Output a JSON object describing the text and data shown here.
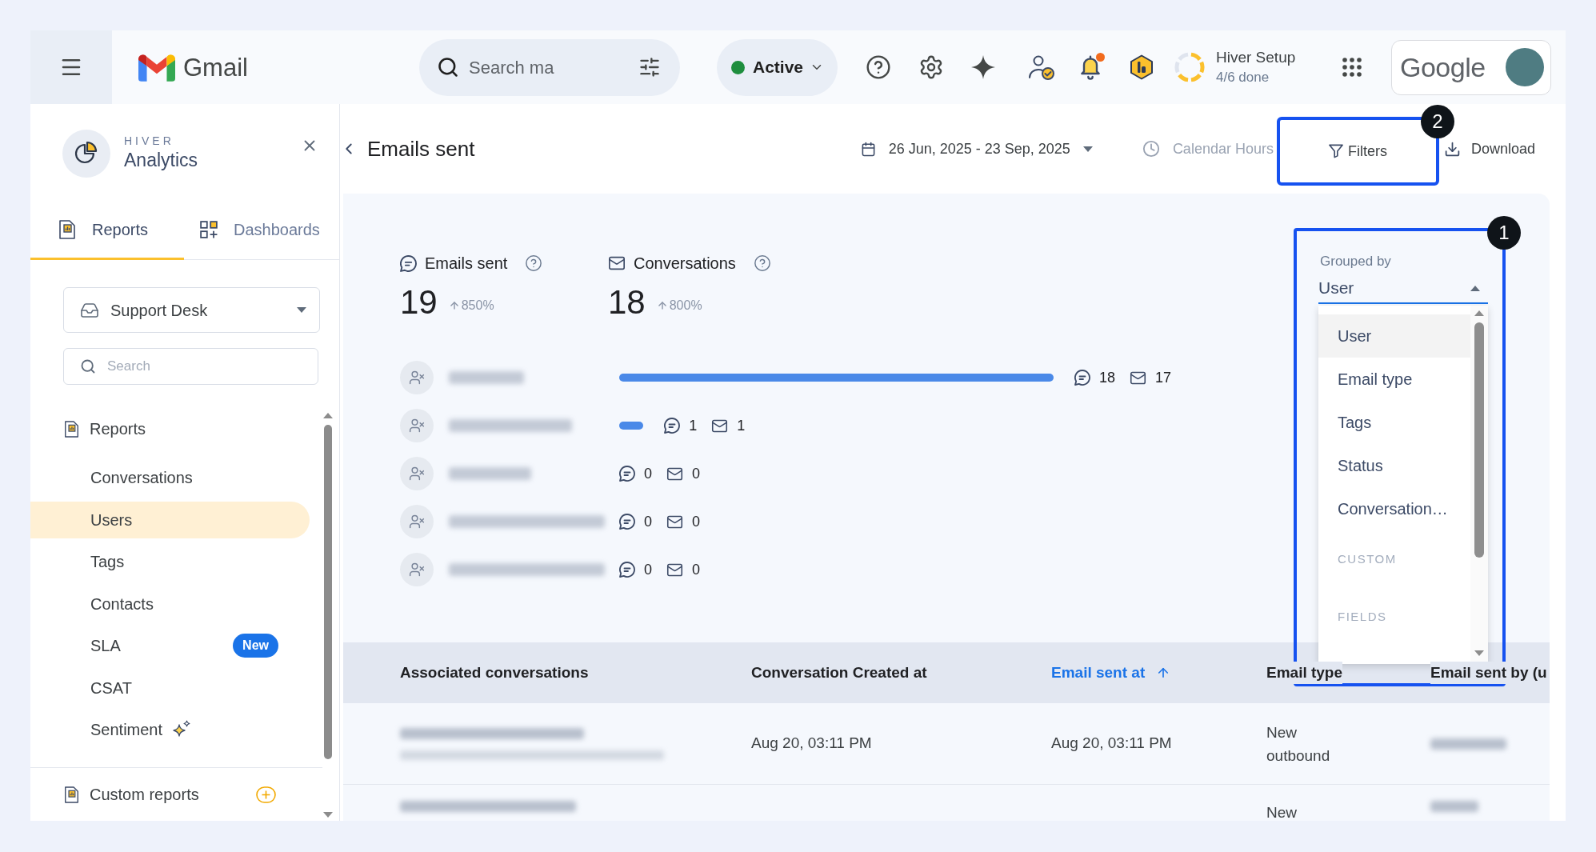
{
  "topbar": {
    "app_name": "Gmail",
    "search": {
      "placeholder": "Search ma"
    },
    "status": {
      "label": "Active"
    },
    "notifications": {
      "unread": true
    },
    "setup": {
      "title": "Hiver Setup",
      "progress": "4/6 done",
      "level": 0.67
    },
    "account": {
      "brand": "Google"
    }
  },
  "sidebar": {
    "overline": "HIVER",
    "title": "Analytics",
    "tabs": [
      {
        "kind": "reports",
        "label": "Reports",
        "selected": true
      },
      {
        "kind": "dashboards",
        "label": "Dashboards",
        "selected": false
      }
    ],
    "inbox": {
      "value": "Support Desk"
    },
    "search": {
      "placeholder": "Search"
    },
    "section": "Reports",
    "items": [
      {
        "kind": "plain",
        "label": "Conversations",
        "selected": false
      },
      {
        "kind": "plain",
        "label": "Users",
        "selected": true
      },
      {
        "kind": "plain",
        "label": "Tags",
        "selected": false
      },
      {
        "kind": "plain",
        "label": "Contacts",
        "selected": false
      },
      {
        "kind": "badged",
        "label": "SLA",
        "badge": "New",
        "selected": false
      },
      {
        "kind": "plain",
        "label": "CSAT",
        "selected": false
      },
      {
        "kind": "sparkle",
        "label": "Sentiment",
        "selected": false
      }
    ],
    "custom_reports": "Custom reports"
  },
  "header": {
    "title": "Emails sent",
    "date_range": "26 Jun, 2025 - 23 Sep, 2025",
    "hours": "Calendar Hours",
    "filters": {
      "label": "Filters",
      "callout": "2"
    },
    "download": "Download"
  },
  "stats": [
    {
      "kind": "emails",
      "label": "Emails sent",
      "value": "19",
      "change": "850%"
    },
    {
      "kind": "conversations",
      "label": "Conversations",
      "value": "18",
      "change": "800%"
    }
  ],
  "users": [
    {
      "emails": "18",
      "conversations": "17"
    },
    {
      "emails": "1",
      "conversations": "1"
    },
    {
      "emails": "0",
      "conversations": "0"
    },
    {
      "emails": "0",
      "conversations": "0"
    },
    {
      "emails": "0",
      "conversations": "0"
    }
  ],
  "grouped_by": {
    "label": "Grouped by",
    "value": "User",
    "expanded": true,
    "callout": "1",
    "options": [
      {
        "kind": "option",
        "label": "User",
        "selected": true
      },
      {
        "kind": "option",
        "label": "Email type",
        "selected": false
      },
      {
        "kind": "option",
        "label": "Tags",
        "selected": false
      },
      {
        "kind": "option",
        "label": "Status",
        "selected": false
      },
      {
        "kind": "option",
        "label": "Conversation…",
        "selected": false
      },
      {
        "kind": "heading",
        "label": "CUSTOM"
      },
      {
        "kind": "heading",
        "label": "FIELDS"
      }
    ]
  },
  "table": {
    "columns": [
      {
        "label": "Associated conversations",
        "sorted": false
      },
      {
        "label": "Conversation Created at",
        "sorted": false
      },
      {
        "label": "Email sent at",
        "sorted": true
      },
      {
        "label": "Email type",
        "sorted": false
      },
      {
        "label": "Email sent by (u",
        "sorted": false
      }
    ],
    "rows": [
      {
        "conversation_created_at": "Aug 20, 03:11 PM",
        "email_sent_at": "Aug 20, 03:11 PM",
        "email_type": "New outbound"
      },
      {
        "email_type": "New"
      }
    ]
  }
}
